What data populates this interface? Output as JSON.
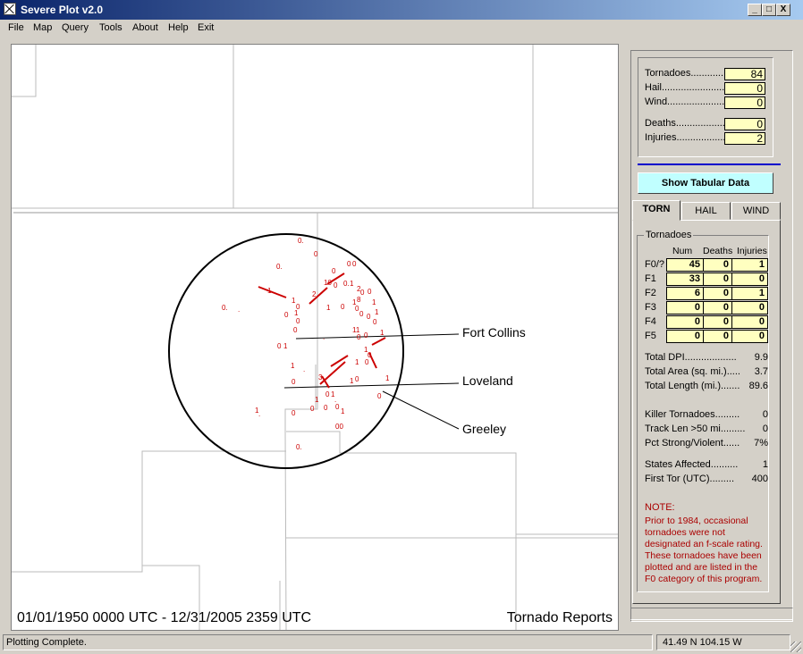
{
  "window": {
    "title": "Severe Plot v2.0",
    "icon": "app-icon",
    "controls": [
      "_",
      "□",
      "X"
    ]
  },
  "menu": [
    "File",
    "Map",
    "Query",
    "Tools",
    "About",
    "Help",
    "Exit"
  ],
  "map": {
    "labels": {
      "fort_collins": "Fort Collins",
      "loveland": "Loveland",
      "greeley": "Greeley"
    },
    "date_range": "01/01/1950 0000 UTC - 12/31/2005 2359 UTC",
    "report_type": "Tornado Reports",
    "marker_color": "#cc0000",
    "report_markers": [
      "0",
      "0.",
      "1",
      "1.",
      "01",
      "10",
      "00",
      "2",
      "3",
      "0 1"
    ]
  },
  "summary": {
    "tornadoes": {
      "label": "Tornadoes............",
      "value": "84"
    },
    "hail": {
      "label": "Hail.........................",
      "value": "0"
    },
    "wind": {
      "label": "Wind........................",
      "value": "0"
    },
    "deaths": {
      "label": "Deaths....................",
      "value": "0"
    },
    "injuries": {
      "label": "Injuries....................",
      "value": "2"
    }
  },
  "show_tabular_button": "Show Tabular Data",
  "tabs": [
    {
      "label": "TORN",
      "active": true
    },
    {
      "label": "HAIL",
      "active": false
    },
    {
      "label": "WIND",
      "active": false
    }
  ],
  "torn_panel": {
    "group_title": "Tornadoes",
    "columns": [
      "Num",
      "Deaths",
      "Injuries"
    ],
    "rows": [
      {
        "label": "F0/?",
        "num": "45",
        "deaths": "0",
        "injuries": "1"
      },
      {
        "label": "F1",
        "num": "33",
        "deaths": "0",
        "injuries": "0"
      },
      {
        "label": "F2",
        "num": "6",
        "deaths": "0",
        "injuries": "1"
      },
      {
        "label": "F3",
        "num": "0",
        "deaths": "0",
        "injuries": "0"
      },
      {
        "label": "F4",
        "num": "0",
        "deaths": "0",
        "injuries": "0"
      },
      {
        "label": "F5",
        "num": "0",
        "deaths": "0",
        "injuries": "0"
      }
    ],
    "stats": [
      {
        "label": "Total DPI...................",
        "value": "9.9"
      },
      {
        "label": "Total Area (sq. mi.).....",
        "value": "3.7"
      },
      {
        "label": "Total Length (mi.).......",
        "value": "89.6"
      },
      {
        "label": "Killer Tornadoes.........",
        "value": "0"
      },
      {
        "label": "Track Len >50 mi.........",
        "value": "0"
      },
      {
        "label": "Pct Strong/Violent......",
        "value": "7%"
      },
      {
        "label": "States Affected..........",
        "value": "1"
      },
      {
        "label": "First Tor (UTC).........",
        "value": "400"
      }
    ],
    "note_heading": "NOTE:",
    "note_text": "Prior to 1984, occasional tornadoes were not designated an f-scale rating. These tornadoes have been plotted and are listed in the F0 category of this program."
  },
  "status": {
    "message": "Plotting Complete.",
    "coords": "41.49 N  104.15 W"
  }
}
